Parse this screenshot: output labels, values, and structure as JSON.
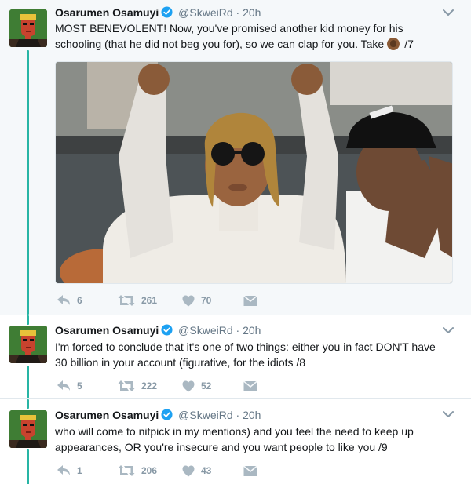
{
  "tweets": [
    {
      "author_name": "Osarumen Osamuyi",
      "handle": "@SkweiRd",
      "separator": "·",
      "time": "20h",
      "text_line1": "MOST BENEVOLENT! Now, you've promised another kid money for his",
      "text_line2a": "schooling (that he did not beg you for), so we can clap for you. Take",
      "text_line2b": "/7",
      "replies": "6",
      "retweets": "261",
      "likes": "70"
    },
    {
      "author_name": "Osarumen Osamuyi",
      "handle": "@SkweiRd",
      "separator": "·",
      "time": "20h",
      "text_line1": "I'm forced to conclude that it's one of two things: either you in fact DON'T have",
      "text_line2": "30 billion in your account (figurative, for the idiots /8",
      "replies": "5",
      "retweets": "222",
      "likes": "52"
    },
    {
      "author_name": "Osarumen Osamuyi",
      "handle": "@SkweiRd",
      "separator": "·",
      "time": "20h",
      "text_line1": "who will come to nitpick in my mentions) and you feel the need to keep up",
      "text_line2": "appearances, OR you're insecure and you want people to like you /9",
      "replies": "1",
      "retweets": "206",
      "likes": "43"
    }
  ],
  "colors": {
    "thread_line": "#28b5a5",
    "verified": "#1da1f2",
    "meta": "#657786",
    "first_tweet_bg": "#f5f8fa"
  },
  "icons": [
    "reply-icon",
    "retweet-icon",
    "like-icon",
    "message-icon",
    "verified-icon",
    "chevron-down-icon",
    "clapping-hands-emoji"
  ]
}
